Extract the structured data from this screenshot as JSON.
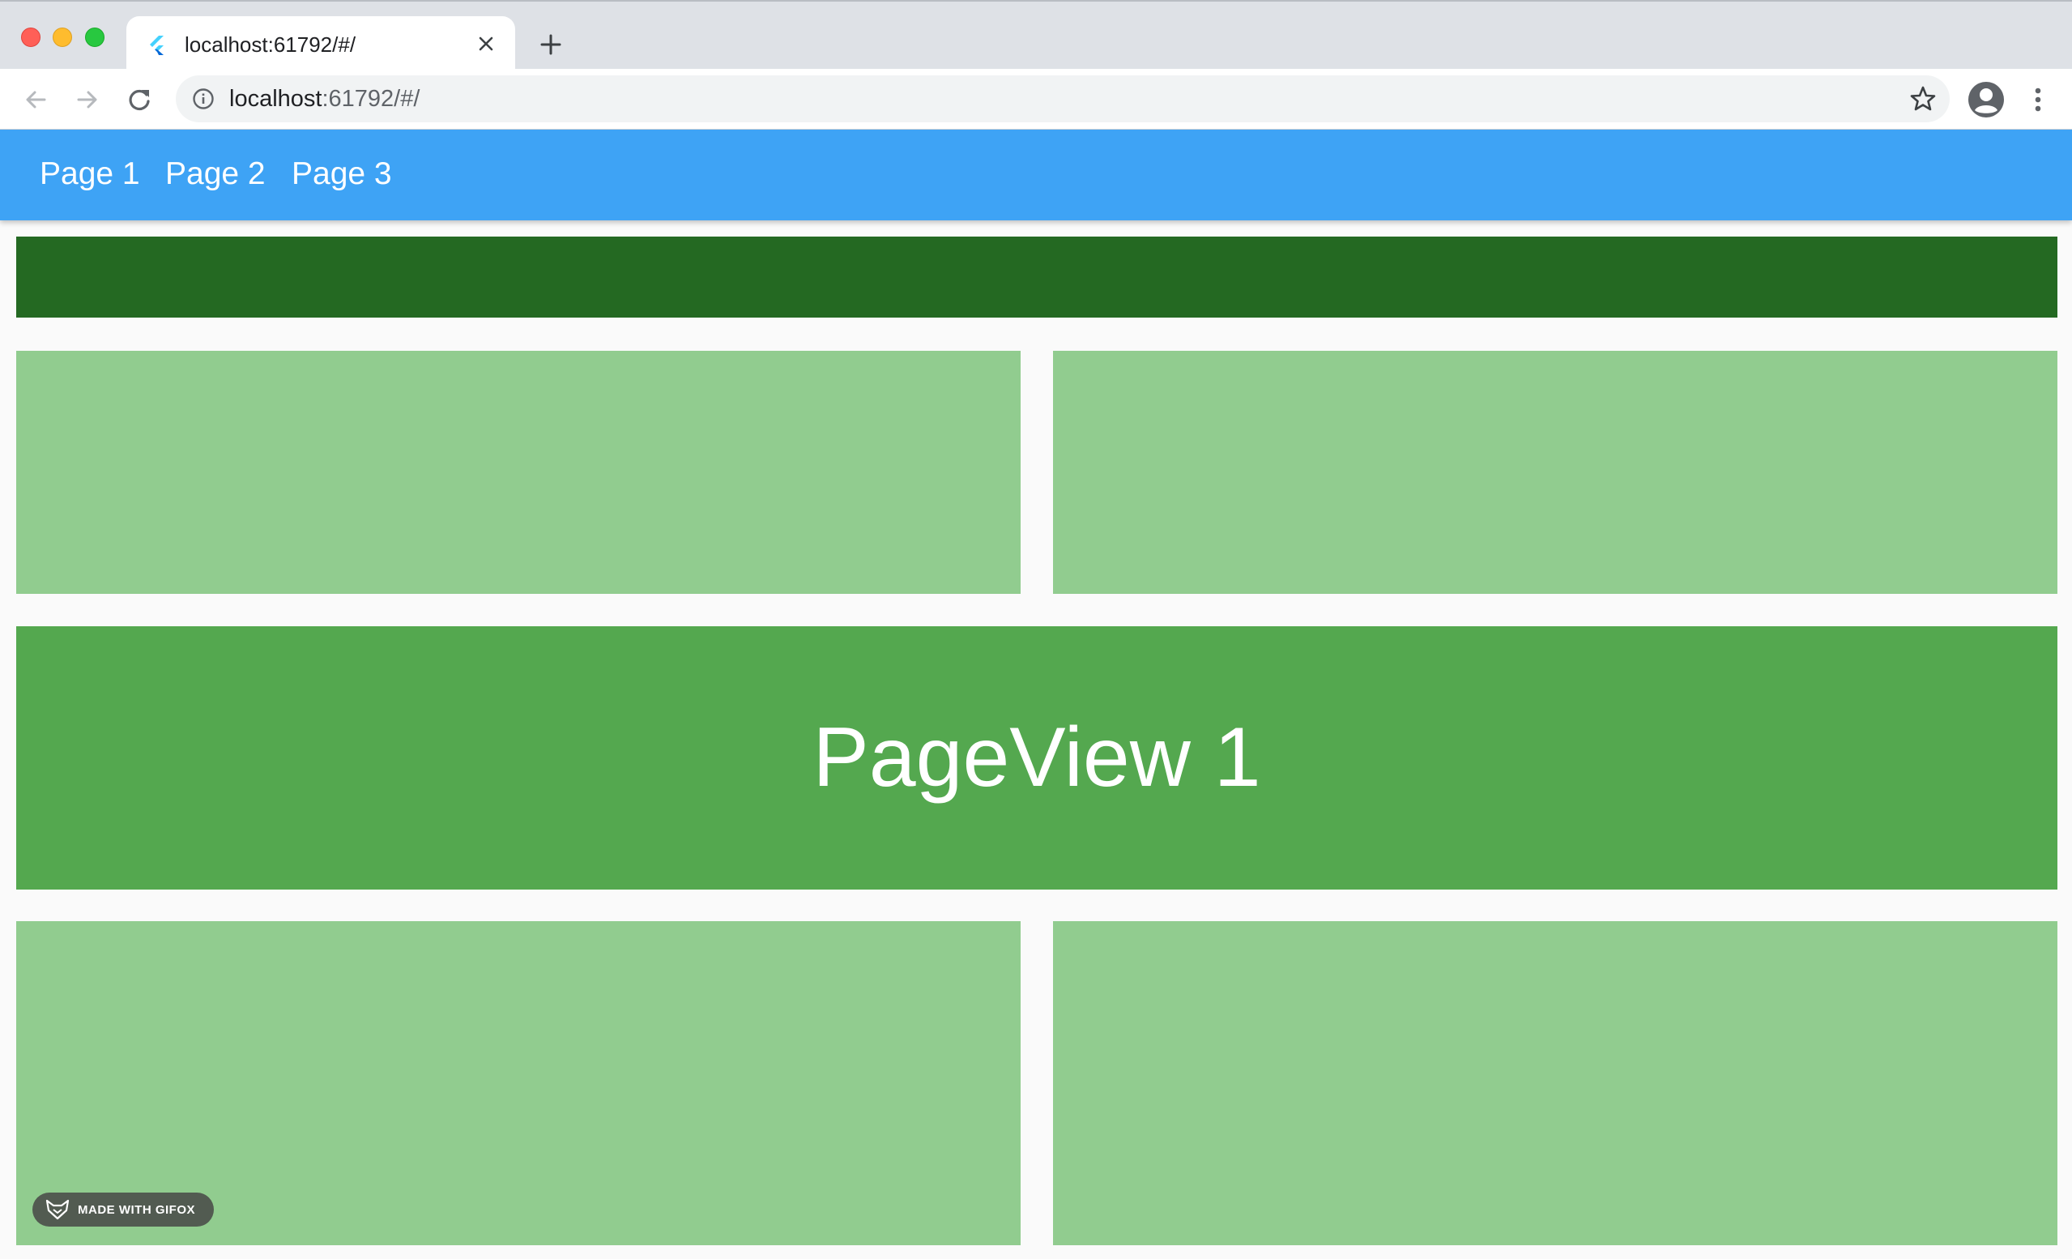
{
  "browser": {
    "tab": {
      "title": "localhost:61792/#/",
      "favicon": "flutter-icon"
    },
    "omnibox": {
      "host": "localhost",
      "rest": ":61792/#/"
    },
    "icons": {
      "back": "arrow-left-icon",
      "forward": "arrow-right-icon",
      "reload": "reload-icon",
      "info": "info-icon",
      "bookmark": "star-icon",
      "profile": "avatar-icon",
      "menu": "kebab-menu-icon",
      "close_tab": "close-icon",
      "new_tab": "plus-icon"
    }
  },
  "app": {
    "appbar_color": "#3ea3f5",
    "tabs": [
      {
        "label": "Page 1"
      },
      {
        "label": "Page 2"
      },
      {
        "label": "Page 3"
      }
    ],
    "colors": {
      "header": "#246922",
      "card": "#91cc8f",
      "pageview": "#54a84f"
    },
    "pageview_label": "PageView 1"
  },
  "watermark": {
    "text": "MADE WITH GIFOX"
  }
}
